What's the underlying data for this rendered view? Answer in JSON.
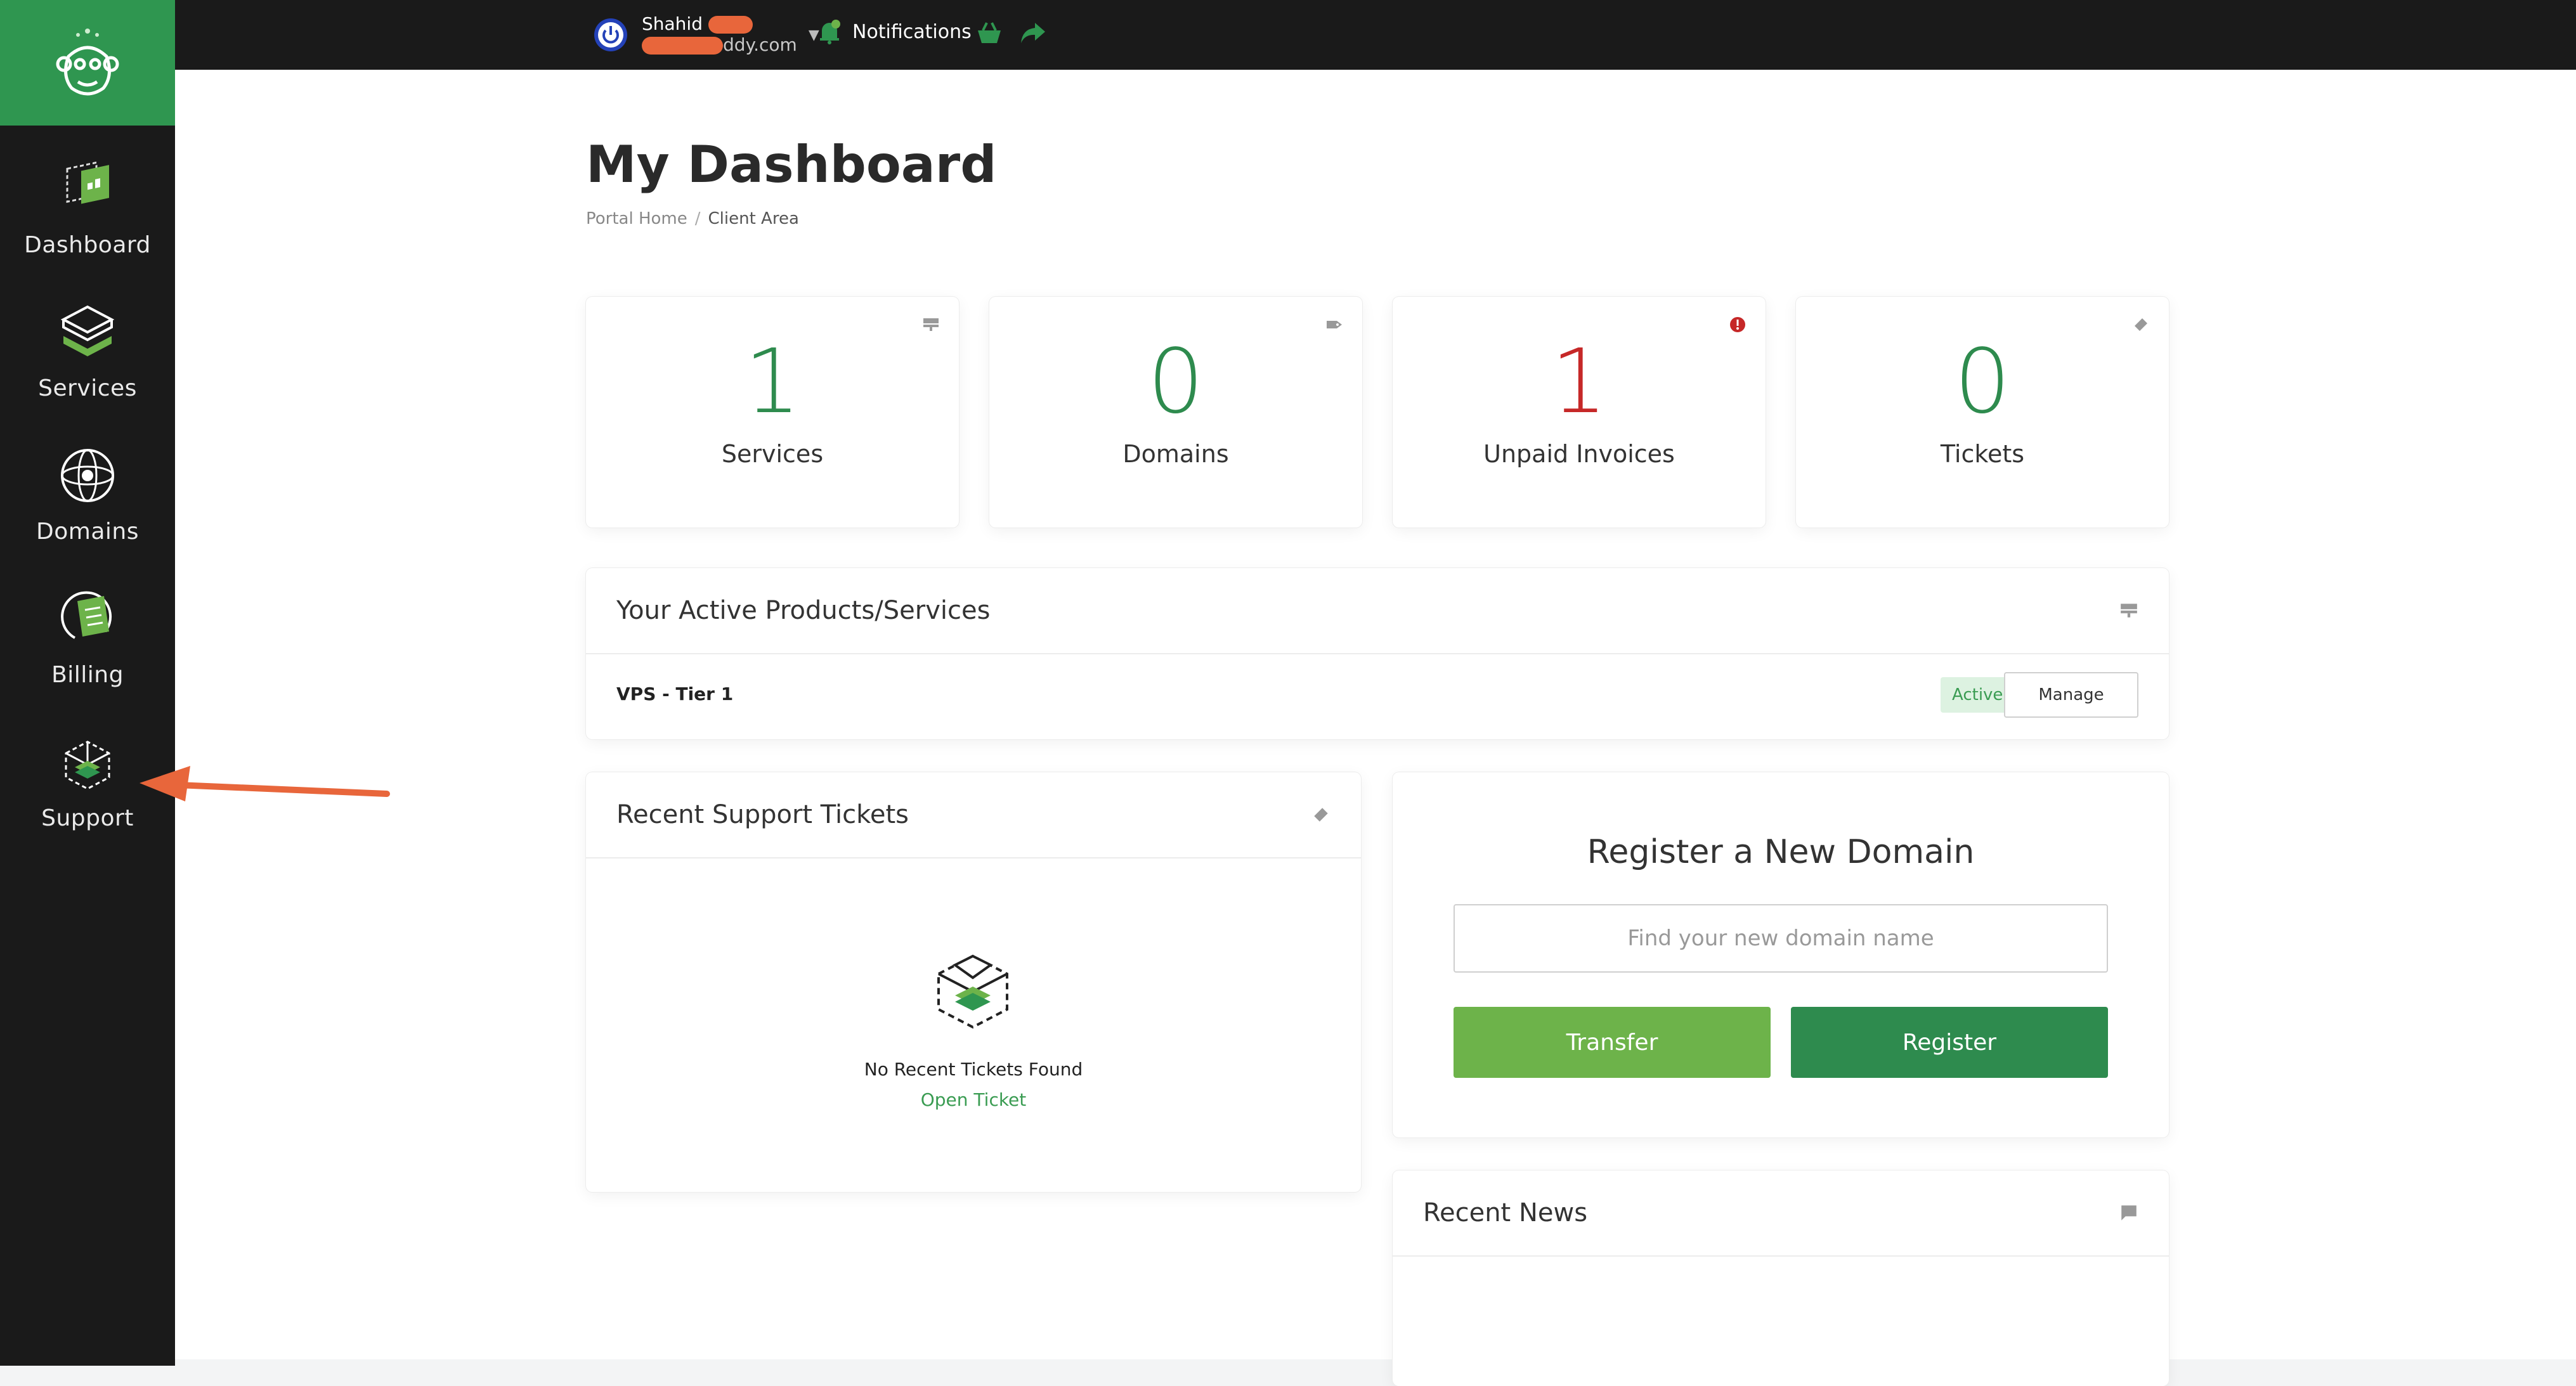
{
  "colors": {
    "sidebar_bg": "#1a1a1a",
    "brand_green": "#2f9650",
    "light_green": "#6db34a",
    "dark_green": "#2e8b4e",
    "danger_red": "#c62828",
    "annotation_arrow": "#e8663b"
  },
  "sidebar": {
    "logo_icon": "monkey-logo-icon",
    "items": [
      {
        "label": "Dashboard",
        "icon": "dashboard-icon"
      },
      {
        "label": "Services",
        "icon": "services-stack-icon"
      },
      {
        "label": "Domains",
        "icon": "globe-icon"
      },
      {
        "label": "Billing",
        "icon": "billing-icon"
      },
      {
        "label": "Support",
        "icon": "support-box-icon"
      }
    ]
  },
  "topbar": {
    "user_name": "Shahid",
    "user_email_suffix": "ddy.com",
    "notifications_label": "Notifications",
    "icons": [
      "power-icon",
      "bell-icon",
      "shopping-basket-icon",
      "share-arrow-icon"
    ]
  },
  "page": {
    "title": "My Dashboard",
    "breadcrumb": {
      "home": "Portal Home",
      "separator": "/",
      "current": "Client Area"
    }
  },
  "stats": [
    {
      "value": "1",
      "label": "Services",
      "color": "#2e8b4e",
      "icon": "server-icon"
    },
    {
      "value": "0",
      "label": "Domains",
      "color": "#2e8b4e",
      "icon": "tag-icon"
    },
    {
      "value": "1",
      "label": "Unpaid Invoices",
      "color": "#c62828",
      "icon": "alert-icon"
    },
    {
      "value": "0",
      "label": "Tickets",
      "color": "#2e8b4e",
      "icon": "ticket-icon"
    }
  ],
  "active_products": {
    "title": "Your Active Products/Services",
    "items": [
      {
        "name": "VPS - Tier 1",
        "status": "Active",
        "action": "Manage"
      }
    ]
  },
  "support_tickets": {
    "title": "Recent Support Tickets",
    "empty_text": "No Recent Tickets Found",
    "open_link": "Open Ticket"
  },
  "register_domain": {
    "title": "Register a New Domain",
    "placeholder": "Find your new domain name",
    "transfer_label": "Transfer",
    "register_label": "Register"
  },
  "recent_news": {
    "title": "Recent News"
  }
}
